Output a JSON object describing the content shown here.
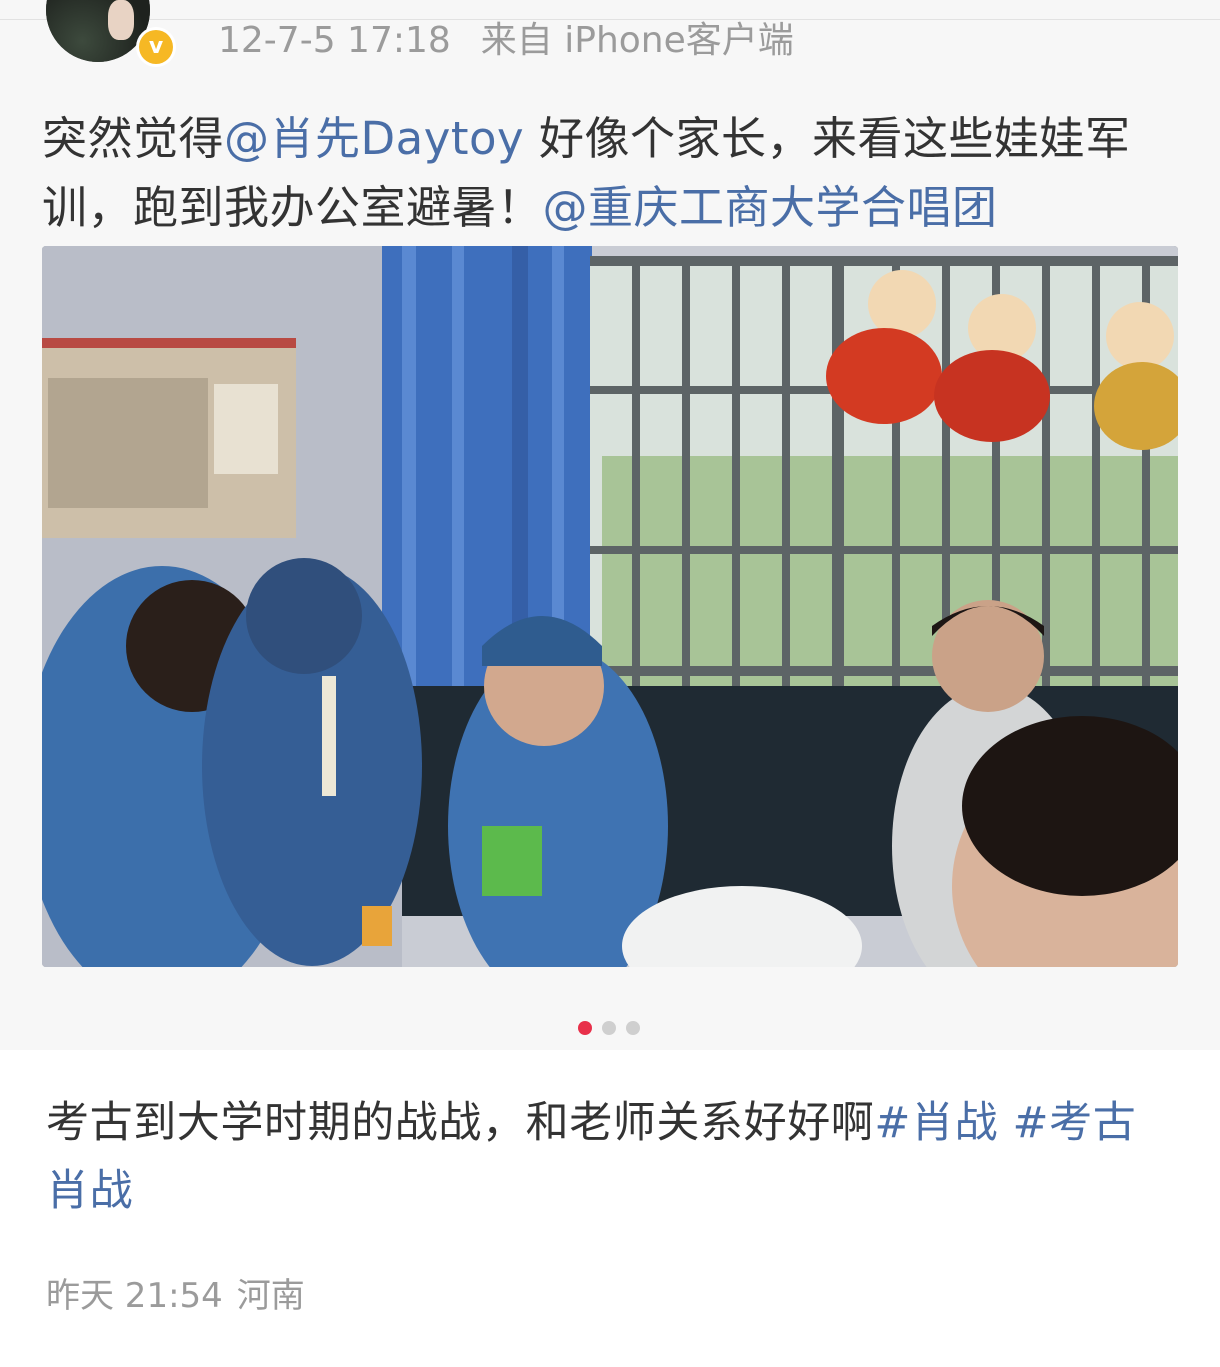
{
  "quoted_post": {
    "timestamp": "12-7-5 17:18",
    "source": "来自 iPhone客户端",
    "text_parts": [
      {
        "text": "突然觉得",
        "kind": "plain"
      },
      {
        "text": "@肖先Daytoy",
        "kind": "mention"
      },
      {
        "text": " 好像个家长，来看这些娃娃军训，跑到我办公室避暑！",
        "kind": "plain"
      },
      {
        "text": "@重庆工商大学合唱团",
        "kind": "mention"
      }
    ],
    "photo": {
      "subject": "photo-students-in-office"
    },
    "carousel": {
      "count": 3,
      "active_index": 0
    }
  },
  "post": {
    "text_parts": [
      {
        "text": "考古到大学时期的战战，和老师关系好好啊",
        "kind": "plain"
      },
      {
        "text": "#肖战",
        "kind": "tag"
      },
      {
        "text": " ",
        "kind": "plain"
      },
      {
        "text": "#考古肖战",
        "kind": "tag"
      }
    ],
    "time": "昨天 21:54",
    "location": "河南"
  },
  "colors": {
    "link": "#4a6ea7",
    "text": "#333333",
    "meta": "#9b9b9b",
    "active_dot": "#e8304a",
    "verified": "#f6b824"
  },
  "icons": {
    "verified": "verified-v-icon"
  }
}
